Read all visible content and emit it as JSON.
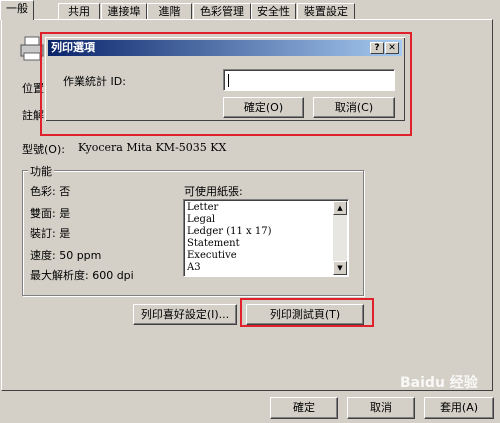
{
  "tabs": [
    "一般",
    "共用",
    "連接埠",
    "進階",
    "色彩管理",
    "安全性",
    "裝置設定"
  ],
  "location_label": "位置",
  "comment_label": "註解",
  "model_label": "型號(O):",
  "model_value": "Kyocera Mita KM-5035 KX",
  "features": {
    "title": "功能",
    "color": "色彩: 否",
    "duplex": "雙面: 是",
    "staple": "裝訂: 是",
    "speed": "速度: 50 ppm",
    "resolution": "最大解析度: 600 dpi",
    "paper_label": "可使用紙張:",
    "paper_items": [
      "Letter",
      "Legal",
      "Ledger (11 x 17)",
      "Statement",
      "Executive",
      "A3"
    ]
  },
  "buttons": {
    "preferences": "列印喜好設定(I)...",
    "test_page": "列印測試頁(T)"
  },
  "dialog": {
    "title": "列印選項",
    "help": "?",
    "close": "✕",
    "job_label": "作業統計 ID:",
    "job_value": "",
    "ok": "確定(O)",
    "cancel": "取消(C)"
  },
  "footer": {
    "ok": "確定",
    "cancel": "取消",
    "apply": "套用(A)"
  },
  "watermark": "Baidu 经验",
  "colors": {
    "highlight": "#e0202a",
    "titlebar": "#0a246a"
  }
}
